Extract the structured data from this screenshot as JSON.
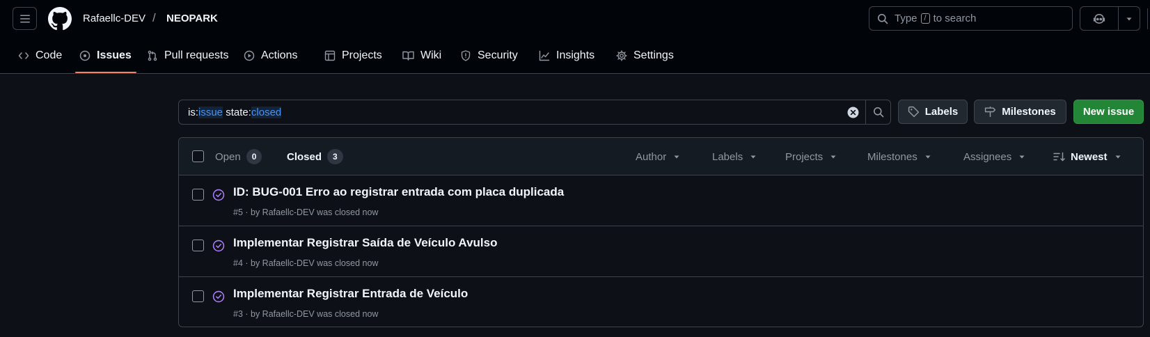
{
  "header": {
    "owner": "Rafaellc-DEV",
    "separator": "/",
    "repo": "NEOPARK",
    "search": {
      "before": "Type",
      "key": "/",
      "after": "to search"
    }
  },
  "nav": {
    "items": [
      {
        "label": "Code",
        "icon": "code-icon"
      },
      {
        "label": "Issues",
        "icon": "issue-opened-icon",
        "active": true
      },
      {
        "label": "Pull requests",
        "icon": "git-pull-request-icon"
      },
      {
        "label": "Actions",
        "icon": "play-icon"
      },
      {
        "label": "Projects",
        "icon": "table-icon"
      },
      {
        "label": "Wiki",
        "icon": "book-icon"
      },
      {
        "label": "Security",
        "icon": "shield-icon"
      },
      {
        "label": "Insights",
        "icon": "graph-icon"
      },
      {
        "label": "Settings",
        "icon": "gear-icon"
      }
    ]
  },
  "toolbar": {
    "query": {
      "k1": "is:",
      "v1": "issue",
      "sp": " ",
      "k2": "state:",
      "v2": "closed"
    },
    "labels_btn": "Labels",
    "milestones_btn": "Milestones",
    "new_issue_btn": "New issue"
  },
  "list": {
    "open_label": "Open",
    "open_count": "0",
    "closed_label": "Closed",
    "closed_count": "3",
    "filters": {
      "author": "Author",
      "labels": "Labels",
      "projects": "Projects",
      "milestones": "Milestones",
      "assignees": "Assignees",
      "sort": "Newest"
    },
    "issues": [
      {
        "title": "ID: BUG-001 Erro ao registrar entrada com placa duplicada",
        "meta": "#5 · by Rafaellc-DEV was closed now"
      },
      {
        "title": "Implementar Registrar Saída de Veículo Avulso",
        "meta": "#4 · by Rafaellc-DEV was closed now"
      },
      {
        "title": "Implementar Registrar Entrada de Veículo",
        "meta": "#3 · by Rafaellc-DEV was closed now"
      }
    ]
  },
  "colors": {
    "background": "#0d1117",
    "header_bg": "#010409",
    "border": "#3d444d",
    "accent_underline": "#f78166",
    "new_issue_green": "#238636",
    "closed_purple": "#ab7df8",
    "query_value_blue": "#4493f8"
  }
}
